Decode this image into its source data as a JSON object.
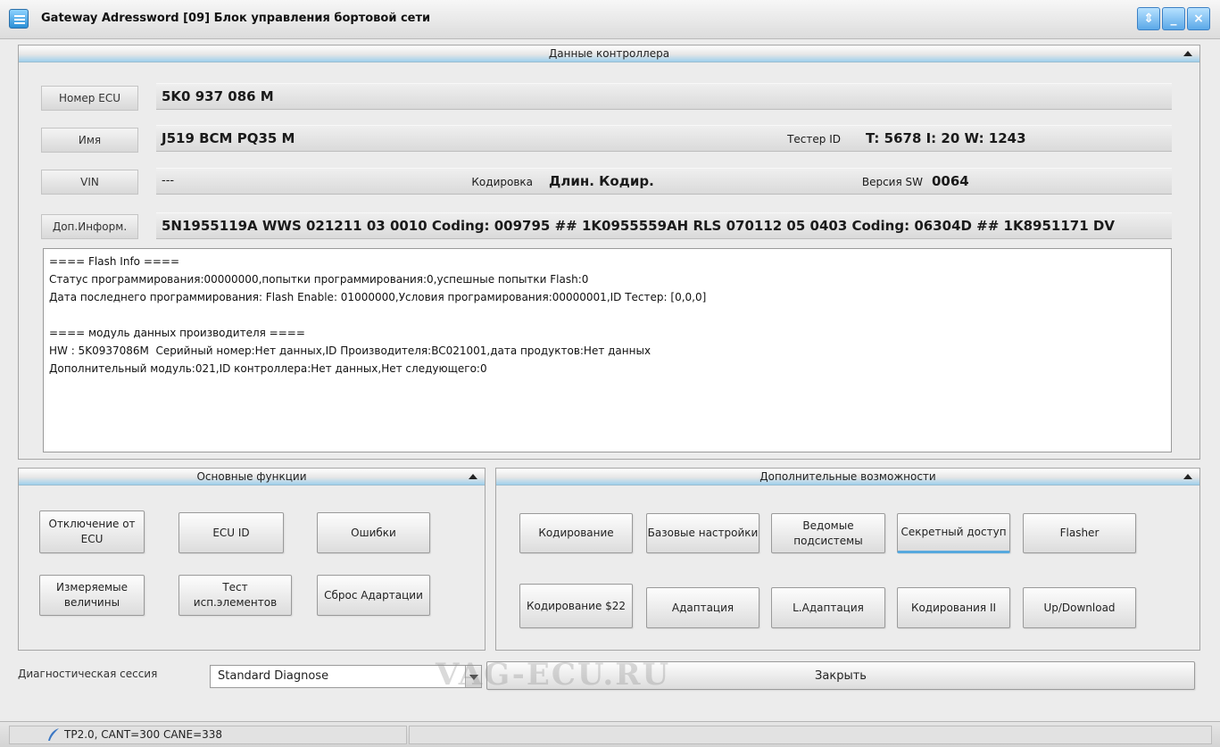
{
  "window": {
    "title": "Gateway Adressword [09] Блок управления бортовой сети",
    "buttons": {
      "restore": "⇕",
      "minimize": "_",
      "close": "×"
    }
  },
  "controller": {
    "header": "Данные контроллера",
    "ecu_label": "Номер ECU",
    "ecu_value": "5K0 937 086 M",
    "name_label": "Имя",
    "name_value": "J519 BCM PQ35 M",
    "tester_label": "Тестер ID",
    "tester_value": "T: 5678 I: 20 W: 1243",
    "vin_label": "VIN",
    "vin_value": "---",
    "coding_label": "Кодировка",
    "coding_value": "Длин. Кодир.",
    "sw_label": "Версия SW",
    "sw_value": "0064",
    "extra_label": "Доп.Информ.",
    "extra_value": "5N1955119A  WWS 021211 03 0010 Coding: 009795 ## 1K0955559AH RLS 070112 05 0403 Coding: 06304D ## 1K8951171   DV"
  },
  "info_text": "==== Flash Info ====\nСтатус программирования:00000000,попытки программирования:0,успешные попытки Flash:0\nДата последнего программирования: Flash Enable: 01000000,Условия програмирования:00000001,ID Тестер: [0,0,0]\n\n==== модуль данных производителя ====\nHW : 5K0937086M  Серийный номер:Нет данных,ID Производителя:BC021001,дата продуктов:Нет данных\nДополнительный модуль:021,ID контроллера:Нет данных,Нет следующего:0",
  "basic": {
    "header": "Основные функции",
    "buttons": [
      "Отключение от ECU",
      "ECU ID",
      "Ошибки",
      "Измеряемые величины",
      "Тест исп.элементов",
      "Сброс Адартации"
    ]
  },
  "advanced": {
    "header": "Дополнительные возможности",
    "buttons": [
      "Кодирование",
      "Базовые настройки",
      "Ведомые подсистемы",
      "Секретный доступ",
      "Flasher",
      "Кодирование $22",
      "Адаптация",
      "L.Адаптация",
      "Кодирования II",
      "Up/Download"
    ]
  },
  "session": {
    "label": "Диагностическая сессия",
    "selected": "Standard Diagnose",
    "close_label": "Закрыть"
  },
  "watermark": "VAG-ECU.RU",
  "status": {
    "text": "TP2.0, CANT=300 CANE=338"
  },
  "icons": {
    "app": "list-icon",
    "status": "feather-icon",
    "accent": "#57a9de"
  }
}
